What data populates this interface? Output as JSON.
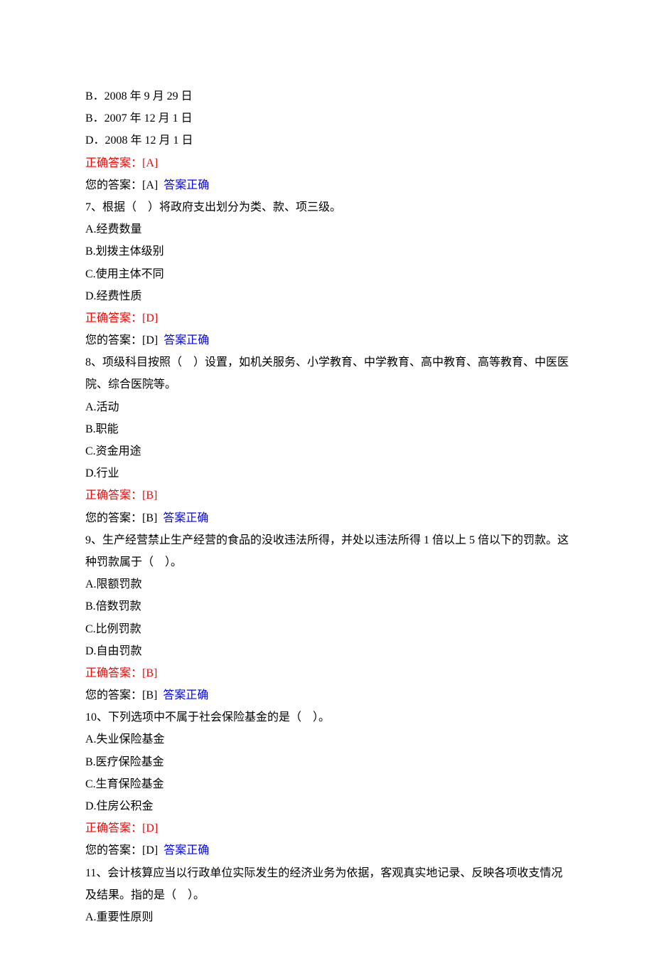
{
  "labels": {
    "correct_answer_prefix": "正确答案：",
    "your_answer_prefix": "您的答案：",
    "verdict_correct": "答案正确"
  },
  "pre_options": [
    "B．2008 年 9 月 29 日",
    "B．2007 年 12 月 1 日",
    "D．2008 年 12 月 1 日"
  ],
  "pre_correct": "[A]",
  "pre_user": "[A]",
  "questions": [
    {
      "q": "7、根据（　）将政府支出划分为类、款、项三级。",
      "options": [
        "A.经费数量",
        "B.划拨主体级别",
        "C.使用主体不同",
        "D.经费性质"
      ],
      "correct": "[D]",
      "user": "[D]"
    },
    {
      "q": "8、项级科目按照（　）设置，如机关服务、小学教育、中学教育、高中教育、高等教育、中医医院、综合医院等。",
      "options": [
        "A.活动",
        "B.职能",
        "C.资金用途",
        "D.行业"
      ],
      "correct": "[B]",
      "user": "[B]"
    },
    {
      "q": "9、生产经营禁止生产经营的食品的没收违法所得，并处以违法所得 1 倍以上 5 倍以下的罚款。这种罚款属于（　）。",
      "options": [
        "A.限额罚款",
        "B.倍数罚款",
        "C.比例罚款",
        "D.自由罚款"
      ],
      "correct": "[B]",
      "user": "[B]"
    },
    {
      "q": "10、下列选项中不属于社会保险基金的是（　）。",
      "options": [
        "A.失业保险基金",
        "B.医疗保险基金",
        "C.生育保险基金",
        "D.住房公积金"
      ],
      "correct": "[D]",
      "user": "[D]"
    },
    {
      "q": "11、会计核算应当以行政单位实际发生的经济业务为依据，客观真实地记录、反映各项收支情况及结果。指的是（　）。",
      "options": [
        "A.重要性原则"
      ],
      "correct": null,
      "user": null
    }
  ]
}
